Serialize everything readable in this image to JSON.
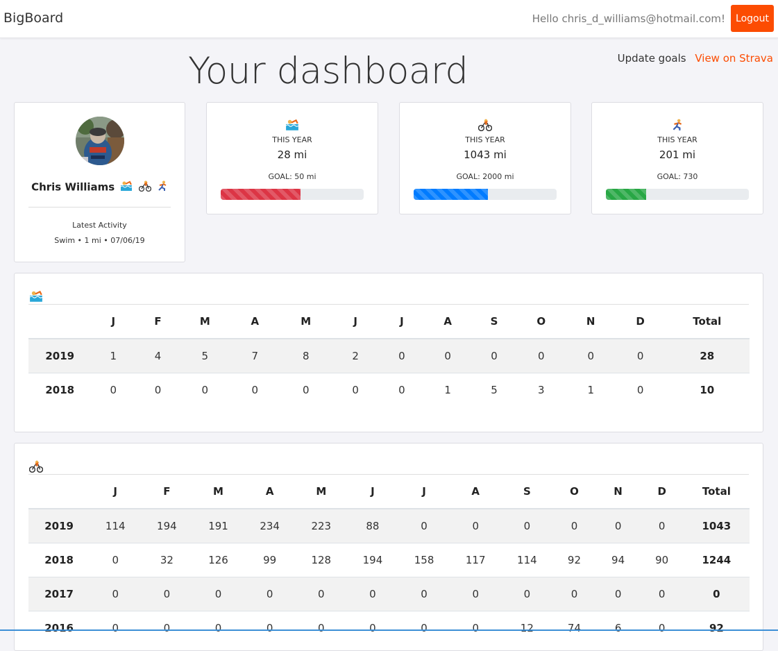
{
  "navbar": {
    "brand": "BigBoard",
    "greeting": "Hello chris_d_williams@hotmail.com!",
    "logout_label": "Logout"
  },
  "links": {
    "update_goals": "Update goals",
    "view_on_strava": "View on Strava"
  },
  "page_title": "Your dashboard",
  "profile": {
    "name": "Chris Williams",
    "latest_label": "Latest Activity",
    "latest_value": "Swim • 1 mi • 07/06/19"
  },
  "stats": [
    {
      "icon": "swim-icon",
      "label": "THIS YEAR",
      "value": "28 mi",
      "goal": "GOAL: 50 mi",
      "progress": 0.56,
      "color": "#dc3545"
    },
    {
      "icon": "bike-icon",
      "label": "THIS YEAR",
      "value": "1043 mi",
      "goal": "GOAL: 2000 mi",
      "progress": 0.52,
      "color": "#007bff"
    },
    {
      "icon": "run-icon",
      "label": "THIS YEAR",
      "value": "201 mi",
      "goal": "GOAL: 730",
      "progress": 0.28,
      "color": "#28a745"
    }
  ],
  "tables": {
    "headers": [
      "J",
      "F",
      "M",
      "A",
      "M",
      "J",
      "J",
      "A",
      "S",
      "O",
      "N",
      "D",
      "Total"
    ],
    "swim": {
      "icon": "swim-icon",
      "rows": [
        {
          "year": "2019",
          "values": [
            "1",
            "4",
            "5",
            "7",
            "8",
            "2",
            "0",
            "0",
            "0",
            "0",
            "0",
            "0"
          ],
          "total": "28"
        },
        {
          "year": "2018",
          "values": [
            "0",
            "0",
            "0",
            "0",
            "0",
            "0",
            "0",
            "1",
            "5",
            "3",
            "1",
            "0"
          ],
          "total": "10"
        }
      ]
    },
    "bike": {
      "icon": "bike-icon",
      "rows": [
        {
          "year": "2019",
          "values": [
            "114",
            "194",
            "191",
            "234",
            "223",
            "88",
            "0",
            "0",
            "0",
            "0",
            "0",
            "0"
          ],
          "total": "1043"
        },
        {
          "year": "2018",
          "values": [
            "0",
            "32",
            "126",
            "99",
            "128",
            "194",
            "158",
            "117",
            "114",
            "92",
            "94",
            "90"
          ],
          "total": "1244"
        },
        {
          "year": "2017",
          "values": [
            "0",
            "0",
            "0",
            "0",
            "0",
            "0",
            "0",
            "0",
            "0",
            "0",
            "0",
            "0"
          ],
          "total": "0"
        },
        {
          "year": "2016",
          "values": [
            "0",
            "0",
            "0",
            "0",
            "0",
            "0",
            "0",
            "0",
            "12",
            "74",
            "6",
            "0"
          ],
          "total": "92"
        }
      ]
    }
  },
  "colors": {
    "accent": "#fc4c02",
    "swim": "#dc3545",
    "bike": "#007bff",
    "run": "#28a745"
  }
}
